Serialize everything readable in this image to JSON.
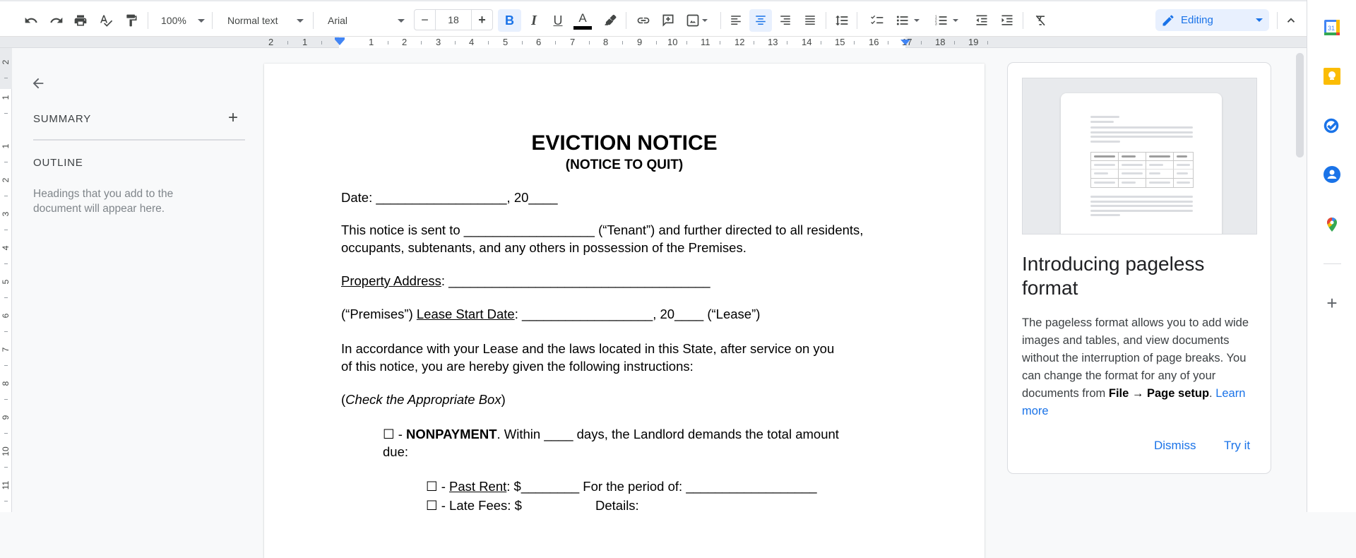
{
  "toolbar": {
    "zoom": "100%",
    "style": "Normal text",
    "font": "Arial",
    "font_size": "18",
    "mode": "Editing",
    "icons": [
      "undo-icon",
      "redo-icon",
      "print-icon",
      "spellcheck-icon",
      "paint-format-icon",
      "decrease-font-icon",
      "increase-font-icon",
      "bold-icon",
      "italic-icon",
      "underline-icon",
      "text-color-icon",
      "highlight-icon",
      "link-icon",
      "add-comment-icon",
      "insert-image-icon",
      "align-left-icon",
      "align-center-icon",
      "align-right-icon",
      "justify-icon",
      "line-spacing-icon",
      "checklist-icon",
      "bulleted-list-icon",
      "numbered-list-icon",
      "decrease-indent-icon",
      "increase-indent-icon",
      "clear-formatting-icon",
      "pencil-icon",
      "collapse-icon"
    ],
    "text_color": "#000000",
    "accent": "#1a73e8"
  },
  "ruler": {
    "horizontal": [
      "2",
      "1",
      "1",
      "2",
      "3",
      "4",
      "5",
      "6",
      "7",
      "8",
      "9",
      "10",
      "11",
      "12",
      "13",
      "14",
      "15",
      "16",
      "17",
      "18",
      "19"
    ],
    "vertical": [
      "2",
      "1",
      "1",
      "2",
      "3",
      "4",
      "5",
      "6",
      "7",
      "8",
      "9",
      "10",
      "11"
    ]
  },
  "sidebar": {
    "back_icon": "arrow-left-icon",
    "summary_label": "SUMMARY",
    "add_icon": "plus-icon",
    "outline_label": "OUTLINE",
    "outline_hint": "Headings that you add to the document will appear here."
  },
  "document": {
    "title": "EVICTION NOTICE",
    "subtitle": "(NOTICE TO QUIT)",
    "date_line": "Date: __________________, 20____",
    "notice_line1": "This notice is sent to __________________ (“Tenant”) and further directed to all residents,",
    "notice_line2": "occupants, subtenants, and any others in possession of the Premises.",
    "property_label": "Property Address",
    "property_rest": ": ____________________________________",
    "premises_prefix": "(“Premises”) ",
    "lease_label": "Lease Start Date",
    "lease_rest": ": __________________, 20____ (“Lease”)",
    "accordance_line1": "In accordance with your Lease and the laws located in this State, after service on you",
    "accordance_line2": "of this notice, you are hereby given the following instructions:",
    "check_open": "(",
    "check_text": "Check the Appropriate Box",
    "check_close": ")",
    "nonpayment_box": "☐ - ",
    "nonpayment_label": "NONPAYMENT",
    "nonpayment_rest": ". Within ____ days, the Landlord demands the total amount",
    "nonpayment_line2": "due:",
    "past_rent_box": "☐ - ",
    "past_rent_label": "Past Rent",
    "past_rent_rest": ": $________ For the period of: __________________",
    "late_fees": "☐ - Late Fees: $",
    "late_details": "Details:"
  },
  "pageless_card": {
    "title": "Introducing pageless format",
    "body_part1": "The pageless format allows you to add wide images and tables, and view documents without the interruption of page breaks. You can change the format for any of your documents from ",
    "body_bold1": "File →",
    "body_bold2": "Page setup",
    "body_period": ". ",
    "learn_more": "Learn more",
    "dismiss": "Dismiss",
    "try_it": "Try it"
  },
  "side_panel": {
    "apps": [
      "calendar-icon",
      "keep-icon",
      "tasks-icon",
      "contacts-icon",
      "maps-icon"
    ],
    "add_icon": "plus-icon",
    "calendar_day": "31"
  }
}
